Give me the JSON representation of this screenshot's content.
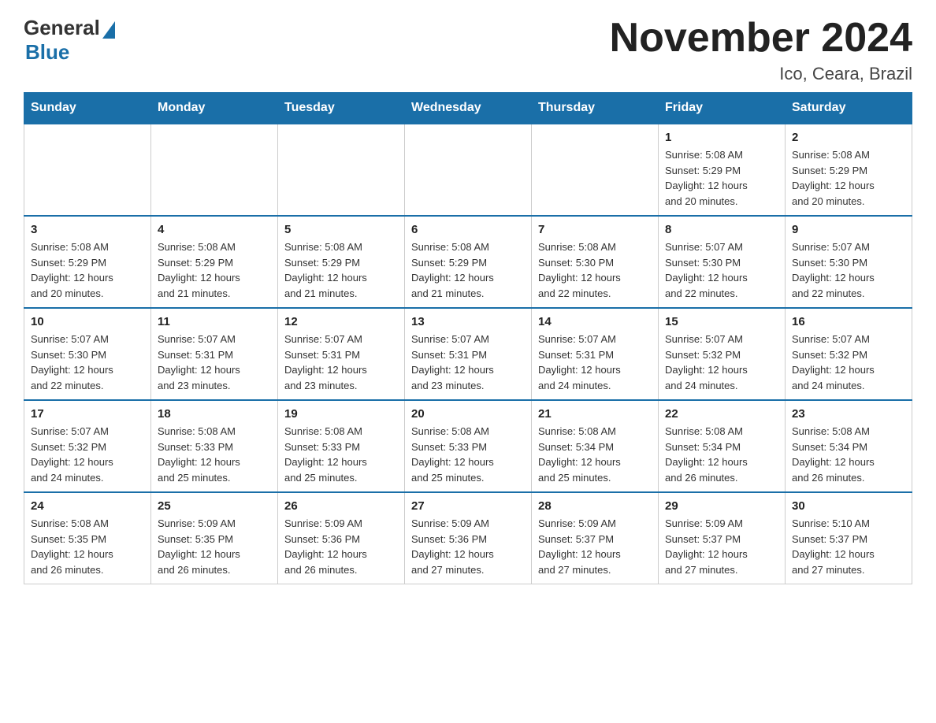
{
  "header": {
    "logo_general": "General",
    "logo_blue": "Blue",
    "title": "November 2024",
    "subtitle": "Ico, Ceara, Brazil"
  },
  "calendar": {
    "weekdays": [
      "Sunday",
      "Monday",
      "Tuesday",
      "Wednesday",
      "Thursday",
      "Friday",
      "Saturday"
    ],
    "weeks": [
      [
        {
          "day": "",
          "info": ""
        },
        {
          "day": "",
          "info": ""
        },
        {
          "day": "",
          "info": ""
        },
        {
          "day": "",
          "info": ""
        },
        {
          "day": "",
          "info": ""
        },
        {
          "day": "1",
          "info": "Sunrise: 5:08 AM\nSunset: 5:29 PM\nDaylight: 12 hours\nand 20 minutes."
        },
        {
          "day": "2",
          "info": "Sunrise: 5:08 AM\nSunset: 5:29 PM\nDaylight: 12 hours\nand 20 minutes."
        }
      ],
      [
        {
          "day": "3",
          "info": "Sunrise: 5:08 AM\nSunset: 5:29 PM\nDaylight: 12 hours\nand 20 minutes."
        },
        {
          "day": "4",
          "info": "Sunrise: 5:08 AM\nSunset: 5:29 PM\nDaylight: 12 hours\nand 21 minutes."
        },
        {
          "day": "5",
          "info": "Sunrise: 5:08 AM\nSunset: 5:29 PM\nDaylight: 12 hours\nand 21 minutes."
        },
        {
          "day": "6",
          "info": "Sunrise: 5:08 AM\nSunset: 5:29 PM\nDaylight: 12 hours\nand 21 minutes."
        },
        {
          "day": "7",
          "info": "Sunrise: 5:08 AM\nSunset: 5:30 PM\nDaylight: 12 hours\nand 22 minutes."
        },
        {
          "day": "8",
          "info": "Sunrise: 5:07 AM\nSunset: 5:30 PM\nDaylight: 12 hours\nand 22 minutes."
        },
        {
          "day": "9",
          "info": "Sunrise: 5:07 AM\nSunset: 5:30 PM\nDaylight: 12 hours\nand 22 minutes."
        }
      ],
      [
        {
          "day": "10",
          "info": "Sunrise: 5:07 AM\nSunset: 5:30 PM\nDaylight: 12 hours\nand 22 minutes."
        },
        {
          "day": "11",
          "info": "Sunrise: 5:07 AM\nSunset: 5:31 PM\nDaylight: 12 hours\nand 23 minutes."
        },
        {
          "day": "12",
          "info": "Sunrise: 5:07 AM\nSunset: 5:31 PM\nDaylight: 12 hours\nand 23 minutes."
        },
        {
          "day": "13",
          "info": "Sunrise: 5:07 AM\nSunset: 5:31 PM\nDaylight: 12 hours\nand 23 minutes."
        },
        {
          "day": "14",
          "info": "Sunrise: 5:07 AM\nSunset: 5:31 PM\nDaylight: 12 hours\nand 24 minutes."
        },
        {
          "day": "15",
          "info": "Sunrise: 5:07 AM\nSunset: 5:32 PM\nDaylight: 12 hours\nand 24 minutes."
        },
        {
          "day": "16",
          "info": "Sunrise: 5:07 AM\nSunset: 5:32 PM\nDaylight: 12 hours\nand 24 minutes."
        }
      ],
      [
        {
          "day": "17",
          "info": "Sunrise: 5:07 AM\nSunset: 5:32 PM\nDaylight: 12 hours\nand 24 minutes."
        },
        {
          "day": "18",
          "info": "Sunrise: 5:08 AM\nSunset: 5:33 PM\nDaylight: 12 hours\nand 25 minutes."
        },
        {
          "day": "19",
          "info": "Sunrise: 5:08 AM\nSunset: 5:33 PM\nDaylight: 12 hours\nand 25 minutes."
        },
        {
          "day": "20",
          "info": "Sunrise: 5:08 AM\nSunset: 5:33 PM\nDaylight: 12 hours\nand 25 minutes."
        },
        {
          "day": "21",
          "info": "Sunrise: 5:08 AM\nSunset: 5:34 PM\nDaylight: 12 hours\nand 25 minutes."
        },
        {
          "day": "22",
          "info": "Sunrise: 5:08 AM\nSunset: 5:34 PM\nDaylight: 12 hours\nand 26 minutes."
        },
        {
          "day": "23",
          "info": "Sunrise: 5:08 AM\nSunset: 5:34 PM\nDaylight: 12 hours\nand 26 minutes."
        }
      ],
      [
        {
          "day": "24",
          "info": "Sunrise: 5:08 AM\nSunset: 5:35 PM\nDaylight: 12 hours\nand 26 minutes."
        },
        {
          "day": "25",
          "info": "Sunrise: 5:09 AM\nSunset: 5:35 PM\nDaylight: 12 hours\nand 26 minutes."
        },
        {
          "day": "26",
          "info": "Sunrise: 5:09 AM\nSunset: 5:36 PM\nDaylight: 12 hours\nand 26 minutes."
        },
        {
          "day": "27",
          "info": "Sunrise: 5:09 AM\nSunset: 5:36 PM\nDaylight: 12 hours\nand 27 minutes."
        },
        {
          "day": "28",
          "info": "Sunrise: 5:09 AM\nSunset: 5:37 PM\nDaylight: 12 hours\nand 27 minutes."
        },
        {
          "day": "29",
          "info": "Sunrise: 5:09 AM\nSunset: 5:37 PM\nDaylight: 12 hours\nand 27 minutes."
        },
        {
          "day": "30",
          "info": "Sunrise: 5:10 AM\nSunset: 5:37 PM\nDaylight: 12 hours\nand 27 minutes."
        }
      ]
    ]
  }
}
